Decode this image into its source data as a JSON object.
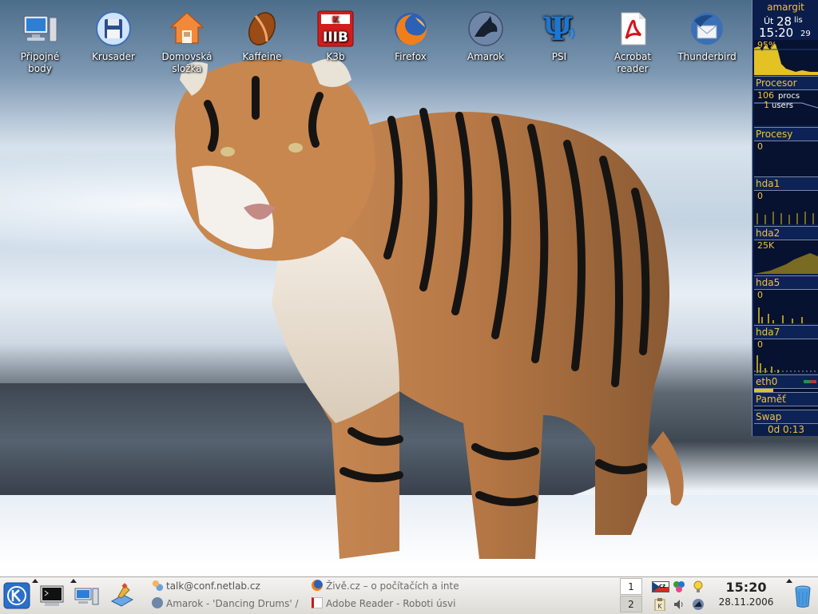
{
  "desktop": {
    "icons": [
      {
        "name": "pripojne-body",
        "label_line1": "Připojné",
        "label_line2": "body"
      },
      {
        "name": "krusader",
        "label_line1": "Krusader",
        "label_line2": ""
      },
      {
        "name": "domovska-slozka",
        "label_line1": "Domovská",
        "label_line2": "složka"
      },
      {
        "name": "kaffeine",
        "label_line1": "Kaffeine",
        "label_line2": ""
      },
      {
        "name": "k3b",
        "label_line1": "K3b",
        "label_line2": ""
      },
      {
        "name": "firefox",
        "label_line1": "Firefox",
        "label_line2": ""
      },
      {
        "name": "amarok",
        "label_line1": "Amarok",
        "label_line2": ""
      },
      {
        "name": "psi",
        "label_line1": "PSI",
        "label_line2": ""
      },
      {
        "name": "acrobat-reader",
        "label_line1": "Acrobat",
        "label_line2": "reader"
      },
      {
        "name": "thunderbird",
        "label_line1": "Thunderbird",
        "label_line2": ""
      }
    ]
  },
  "monitor": {
    "hostname": "amargit",
    "clock": {
      "weekday": "Út",
      "day": "28",
      "month": "lis",
      "time": "15:20",
      "seconds": "29"
    },
    "cpu_percent": "95%",
    "sections": {
      "processor": "Procesor",
      "procs_count": "106",
      "procs_unit": "procs",
      "users_count": "1",
      "users_unit": "users",
      "processes": "Procesy",
      "processes_value": "0",
      "hda1": "hda1",
      "hda1_value": "0",
      "hda2": "hda2",
      "hda2_value": "25K",
      "hda5": "hda5",
      "hda5_value": "0",
      "hda7": "hda7",
      "hda7_value": "0",
      "eth0": "eth0",
      "memory": "Paměť",
      "swap": "Swap",
      "uptime": "0d  0:13"
    }
  },
  "taskbar": {
    "tasks": [
      {
        "label": "talk@conf.netlab.cz"
      },
      {
        "label": "Živě.cz – o počítačích a inte"
      },
      {
        "label": "Amarok - 'Dancing Drums' /"
      },
      {
        "label": "Adobe Reader - Roboti úsvi"
      }
    ],
    "pager": {
      "desktop1": "1",
      "desktop2": "2"
    },
    "clock": {
      "time": "15:20",
      "date": "28.11.2006"
    },
    "keyboard_layout": "cz"
  }
}
